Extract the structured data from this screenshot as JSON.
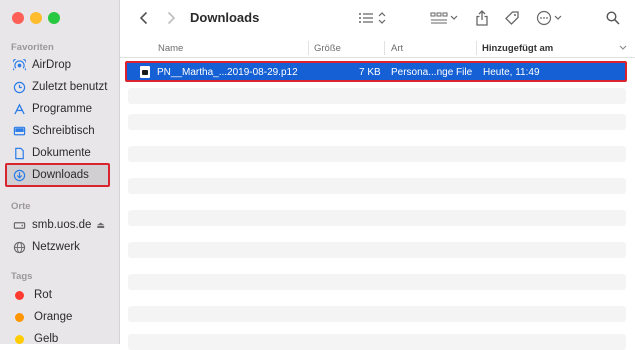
{
  "sidebar": {
    "favorites_label": "Favoriten",
    "favorites": [
      {
        "label": "AirDrop",
        "icon": "airdrop-icon"
      },
      {
        "label": "Zuletzt benutzt",
        "icon": "clock-icon"
      },
      {
        "label": "Programme",
        "icon": "apps-icon"
      },
      {
        "label": "Schreibtisch",
        "icon": "desktop-icon"
      },
      {
        "label": "Dokumente",
        "icon": "document-icon"
      },
      {
        "label": "Downloads",
        "icon": "download-icon"
      }
    ],
    "locations_label": "Orte",
    "locations": [
      {
        "label": "smb.uos.de",
        "icon": "server-icon"
      },
      {
        "label": "Netzwerk",
        "icon": "globe-icon"
      }
    ],
    "tags_label": "Tags",
    "tags": [
      {
        "label": "Rot",
        "color": "#ff3b30"
      },
      {
        "label": "Orange",
        "color": "#ff9500"
      },
      {
        "label": "Gelb",
        "color": "#ffcc00"
      }
    ]
  },
  "toolbar": {
    "title": "Downloads"
  },
  "columns": {
    "name": "Name",
    "size": "Größe",
    "kind": "Art",
    "added": "Hinzugefügt am"
  },
  "files": [
    {
      "name": "PN__Martha_...2019-08-29.p12",
      "size": "7 KB",
      "kind": "Persona...nge File",
      "added": "Heute, 11:49"
    }
  ],
  "colors": {
    "selection": "#1560d4",
    "highlight_box": "#d9232f",
    "accent": "#1d6fe0"
  }
}
